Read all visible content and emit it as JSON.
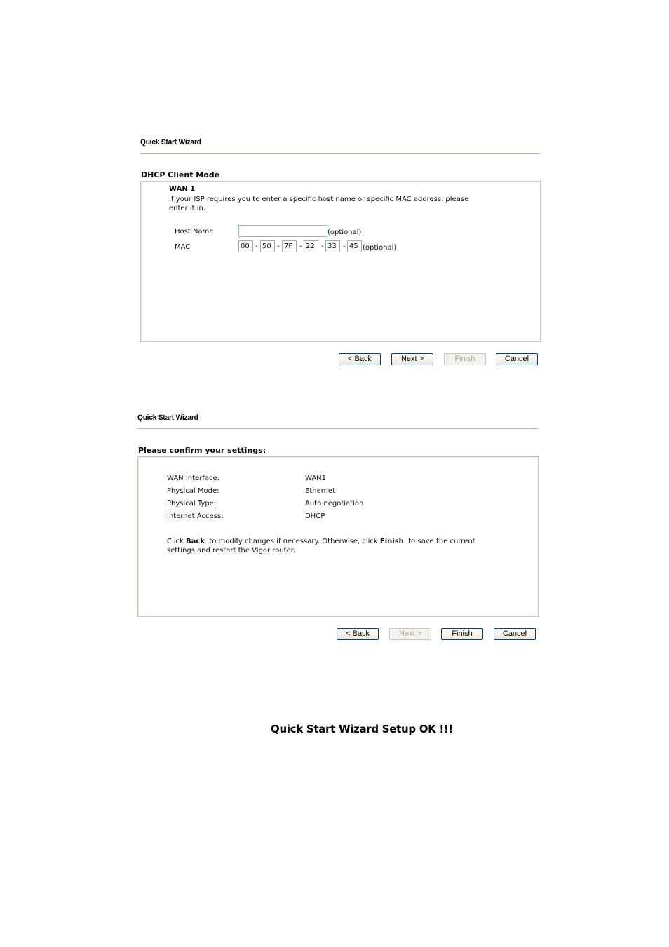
{
  "dhcp_screen": {
    "wizard_title": "Quick Start Wizard",
    "section_title": "DHCP Client Mode",
    "wan_label": "WAN 1",
    "description_line1": "If your ISP requires you to enter a specific host name or specific MAC address, please",
    "description_line2": "enter it in.",
    "host_name_label": "Host Name",
    "host_name_value": "",
    "host_name_optional": "(optional)",
    "mac_label": "MAC",
    "mac_octets": [
      "00",
      "50",
      "7F",
      "22",
      "33",
      "45"
    ],
    "mac_separator": "-",
    "mac_optional": "(optional)",
    "buttons": {
      "back": "< Back",
      "next": "Next >",
      "finish": "Finish",
      "cancel": "Cancel"
    }
  },
  "confirm_screen": {
    "wizard_title": "Quick Start Wizard",
    "section_title": "Please confirm your settings:",
    "settings": [
      {
        "label": "WAN Interface:",
        "value": "WAN1"
      },
      {
        "label": "Physical Mode:",
        "value": "Ethernet"
      },
      {
        "label": "Physical Type:",
        "value": "Auto negotiation"
      },
      {
        "label": "Internet Access:",
        "value": "DHCP"
      }
    ],
    "note_part1": "Click ",
    "note_back": "Back",
    "note_part2": "  to modify changes if necessary. Otherwise, click ",
    "note_finish": "Finish",
    "note_part3": "  to save the current",
    "note_line2": "settings and restart the Vigor router.",
    "buttons": {
      "back": "< Back",
      "next": "Next >",
      "finish": "Finish",
      "cancel": "Cancel"
    }
  },
  "success_message": "Quick Start Wizard Setup OK !!!"
}
